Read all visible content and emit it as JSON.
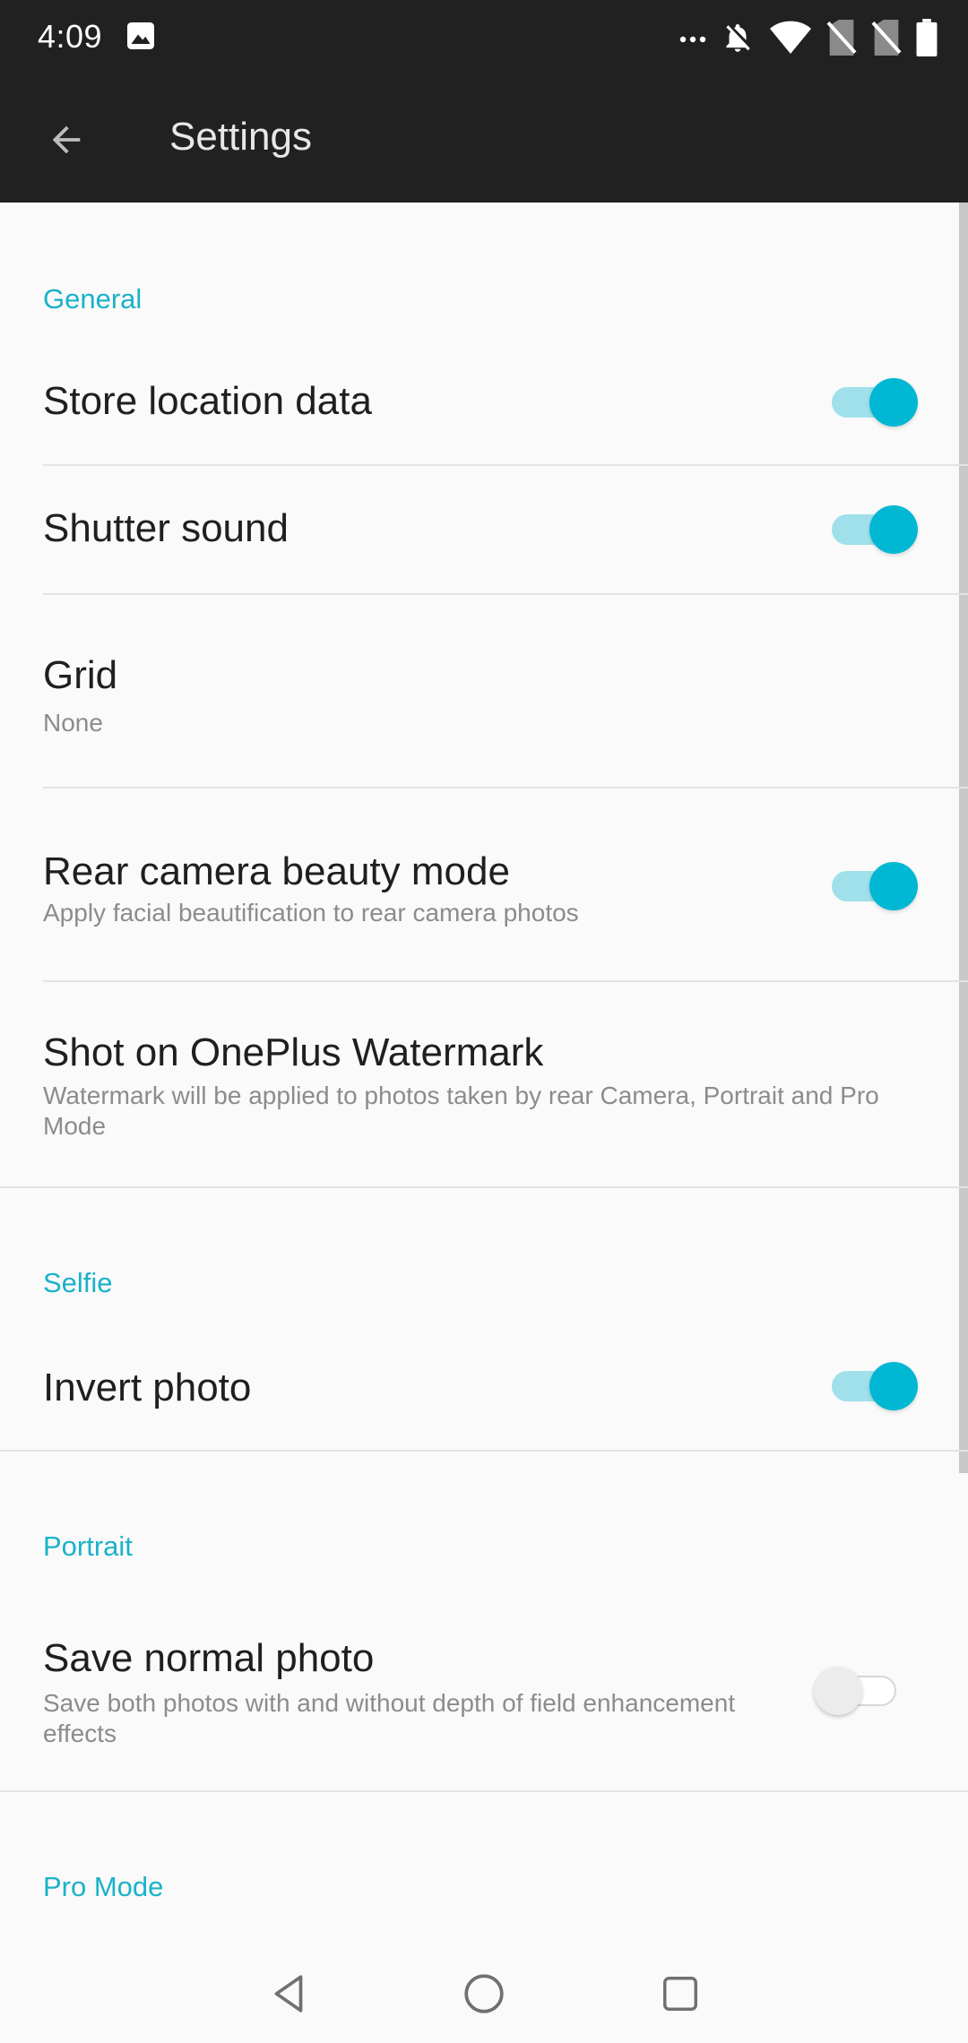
{
  "status_bar": {
    "time": "4:09",
    "icons": [
      "image-icon",
      "more-icon",
      "notifications-off-icon",
      "wifi-icon",
      "no-sim-icon",
      "no-sim-icon",
      "battery-icon"
    ]
  },
  "app_bar": {
    "title": "Settings",
    "back_icon": "arrow-back-icon"
  },
  "sections": {
    "general": {
      "header": "General",
      "store_location": {
        "title": "Store location data",
        "enabled": true
      },
      "shutter_sound": {
        "title": "Shutter sound",
        "enabled": true
      },
      "grid": {
        "title": "Grid",
        "value": "None"
      },
      "rear_beauty": {
        "title": "Rear camera beauty mode",
        "subtitle": "Apply facial beautification to rear camera photos",
        "enabled": true
      },
      "watermark": {
        "title": "Shot on OnePlus Watermark",
        "subtitle": "Watermark will be applied to photos taken by rear Camera, Portrait and Pro Mode"
      }
    },
    "selfie": {
      "header": "Selfie",
      "invert_photo": {
        "title": "Invert photo",
        "enabled": true
      }
    },
    "portrait": {
      "header": "Portrait",
      "save_normal": {
        "title": "Save normal photo",
        "subtitle": "Save both photos with and without depth of field enhancement effects",
        "enabled": false
      }
    },
    "pro_mode": {
      "header": "Pro Mode"
    }
  },
  "colors": {
    "accent": "#00b8d4",
    "section_header": "#1ab2c9",
    "app_bar": "#212121",
    "background": "#fafafa"
  },
  "nav_bar": {
    "icons": [
      "nav-back-icon",
      "nav-home-icon",
      "nav-recents-icon"
    ]
  }
}
